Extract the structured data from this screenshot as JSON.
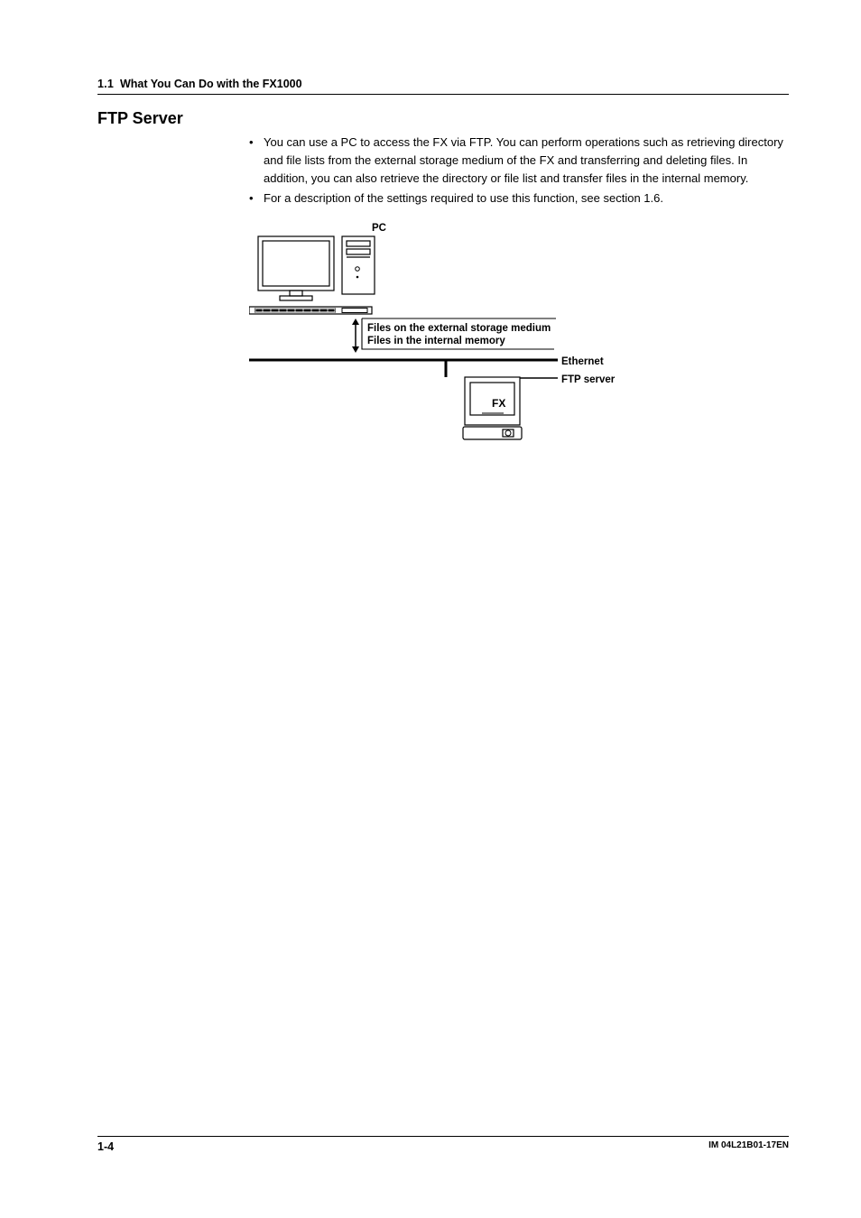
{
  "header": {
    "section_number": "1.1",
    "section_title": "What You Can Do with the FX1000"
  },
  "subheading": "FTP Server",
  "bullets": [
    "You can use a PC to access the FX via FTP. You can perform operations such as retrieving directory and file lists from the external storage medium of the FX and transferring and deleting files. In addition, you can also retrieve the directory or file list and transfer files in the internal memory.",
    "For a description of the settings required to use this function, see section 1.6."
  ],
  "diagram": {
    "pc_label": "PC",
    "files_label_1": "Files on the external storage medium",
    "files_label_2": "Files in the internal memory",
    "ethernet_label": "Ethernet",
    "ftp_label": "FTP server",
    "fx_label": "FX"
  },
  "footer": {
    "left": "1-4",
    "right": "IM 04L21B01-17EN"
  }
}
